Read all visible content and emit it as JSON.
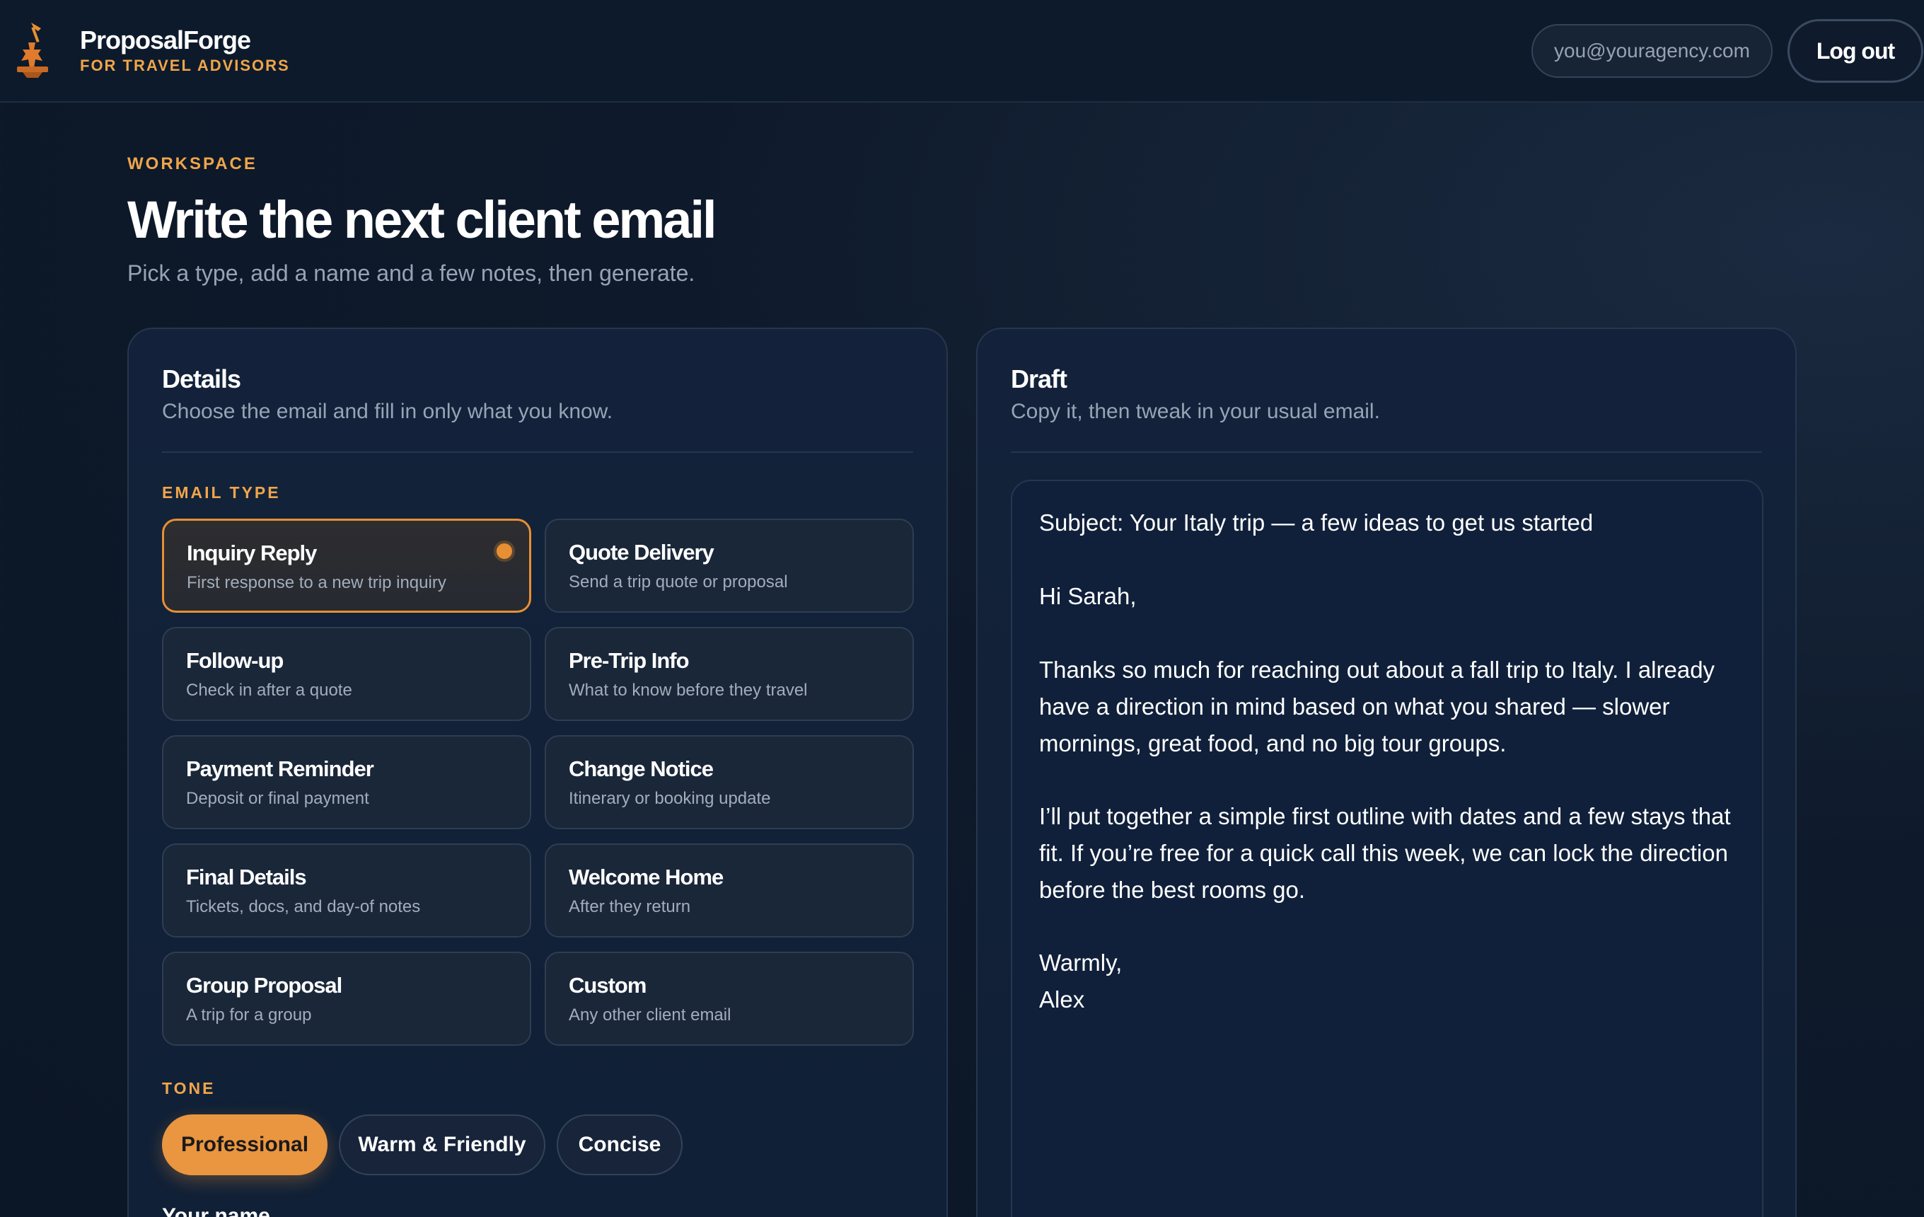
{
  "header": {
    "brand_name": "ProposalForge",
    "brand_tag": "FOR TRAVEL ADVISORS",
    "user_email": "you@youragency.com",
    "logout_label": "Log out"
  },
  "intro": {
    "eyebrow": "WORKSPACE",
    "title": "Write the next client email",
    "subtitle": "Pick a type, add a name and a few notes, then generate."
  },
  "details": {
    "title": "Details",
    "subtitle": "Choose the email and fill in only what you know.",
    "email_type_label": "EMAIL TYPE",
    "email_types": [
      {
        "title": "Inquiry Reply",
        "desc": "First response to a new trip inquiry",
        "selected": true
      },
      {
        "title": "Quote Delivery",
        "desc": "Send a trip quote or proposal",
        "selected": false
      },
      {
        "title": "Follow-up",
        "desc": "Check in after a quote",
        "selected": false
      },
      {
        "title": "Pre-Trip Info",
        "desc": "What to know before they travel",
        "selected": false
      },
      {
        "title": "Payment Reminder",
        "desc": "Deposit or final payment",
        "selected": false
      },
      {
        "title": "Change Notice",
        "desc": "Itinerary or booking update",
        "selected": false
      },
      {
        "title": "Final Details",
        "desc": "Tickets, docs, and day-of notes",
        "selected": false
      },
      {
        "title": "Welcome Home",
        "desc": "After they return",
        "selected": false
      },
      {
        "title": "Group Proposal",
        "desc": "A trip for a group",
        "selected": false
      },
      {
        "title": "Custom",
        "desc": "Any other client email",
        "selected": false
      }
    ],
    "tone_label": "TONE",
    "tones": [
      {
        "label": "Professional",
        "active": true
      },
      {
        "label": "Warm & Friendly",
        "active": false
      },
      {
        "label": "Concise",
        "active": false
      }
    ],
    "your_name_label": "Your name"
  },
  "draft": {
    "title": "Draft",
    "subtitle": "Copy it, then tweak in your usual email.",
    "lines": [
      "Subject: Your Italy trip — a few ideas to get us started",
      "",
      "Hi Sarah,",
      "",
      "Thanks so much for reaching out about a fall trip to Italy. I already",
      "have a direction in mind based on what you shared — slower",
      "mornings, great food, and no big tour groups.",
      "",
      "I’ll put together a simple first outline with dates and a few stays that",
      "fit. If you’re free for a quick call this week, we can lock the direction",
      "before the best rooms go.",
      "",
      "Warmly,",
      "Alex"
    ]
  },
  "colors": {
    "accent": "#ea9540",
    "background": "#0e1a2b",
    "panel": "#13223a"
  }
}
